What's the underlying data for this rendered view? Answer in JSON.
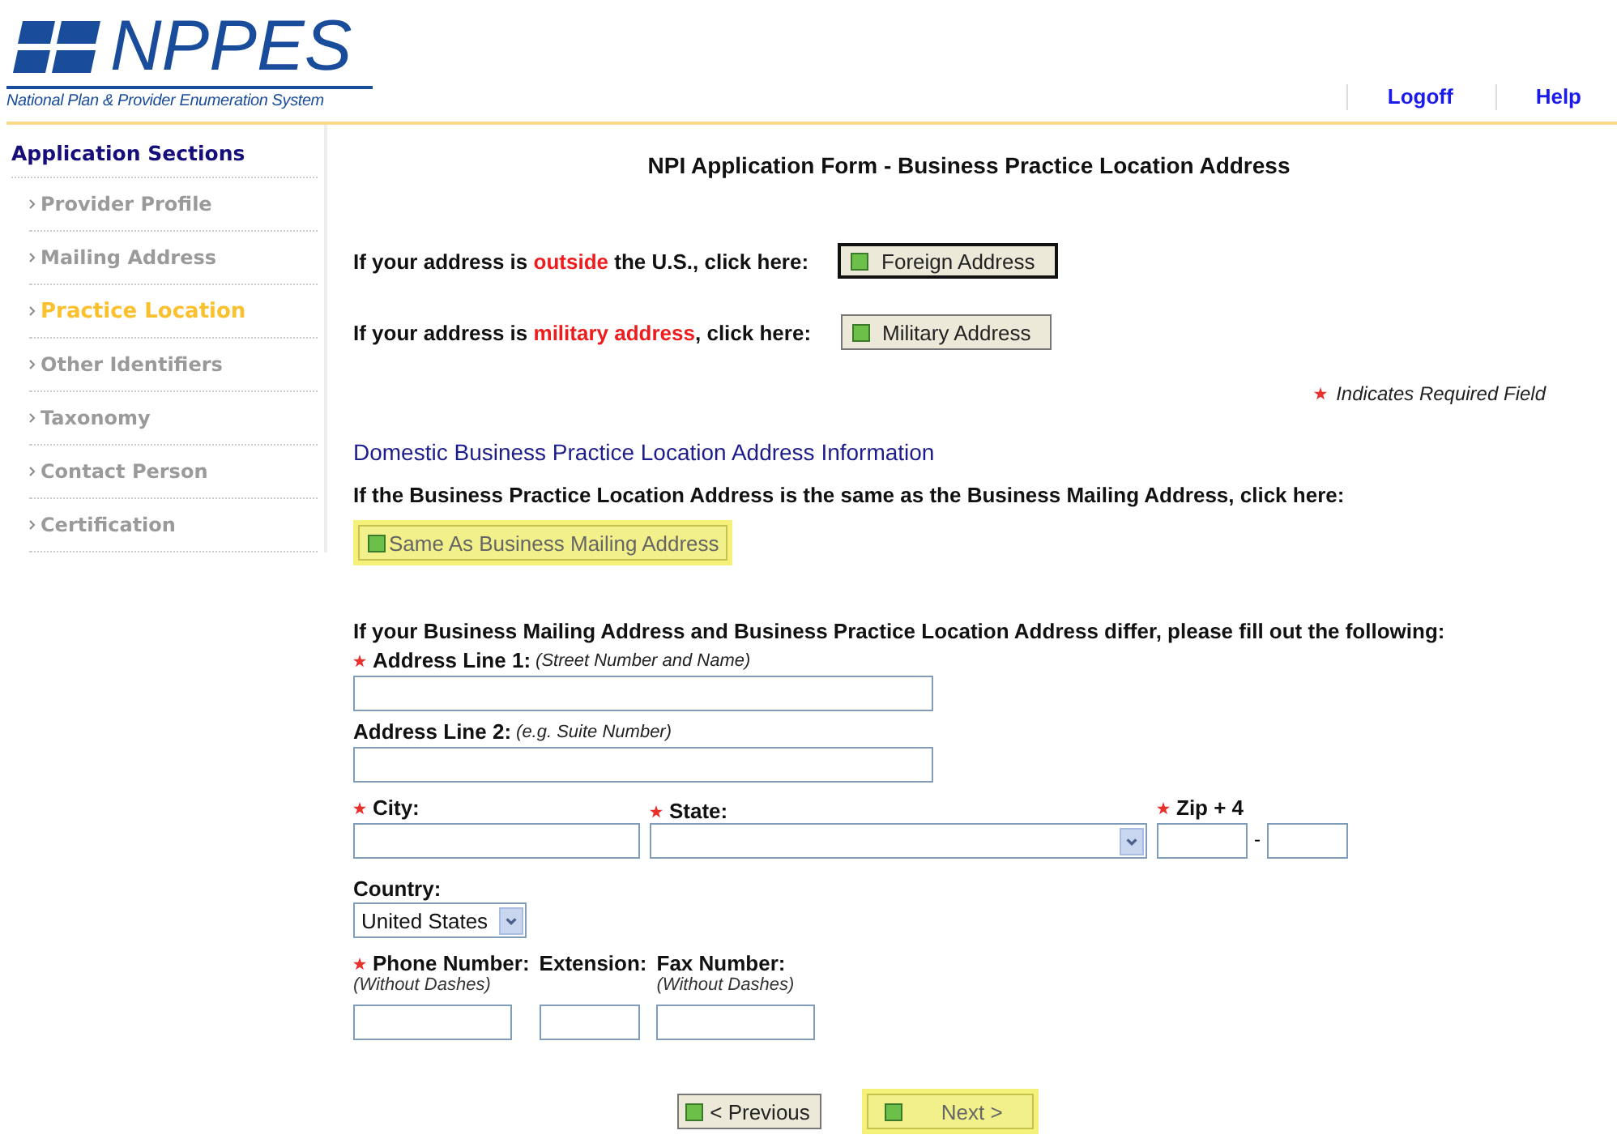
{
  "logo": {
    "name": "NPPES",
    "tagline": "National Plan & Provider Enumeration System"
  },
  "top_links": [
    {
      "label": "Logoff"
    },
    {
      "label": "Help"
    }
  ],
  "sidebar": {
    "title": "Application Sections",
    "items": [
      {
        "label": "Provider Profile",
        "selected": false
      },
      {
        "label": "Mailing Address",
        "selected": false
      },
      {
        "label": "Practice Location",
        "selected": true
      },
      {
        "label": "Other Identifiers",
        "selected": false
      },
      {
        "label": "Taxonomy",
        "selected": false
      },
      {
        "label": "Contact Person",
        "selected": false
      },
      {
        "label": "Certification",
        "selected": false
      }
    ]
  },
  "page_title": "NPI Application Form - Business Practice Location Address",
  "address_options": [
    {
      "before": "If your address is ",
      "emphasis": "outside",
      "after": " the U.S., click here:",
      "button": {
        "label": "Foreign Address",
        "focused": true
      }
    },
    {
      "before": "If your address is ",
      "emphasis": "military address",
      "after": ", click here:",
      "button": {
        "label": "Military Address",
        "focused": false
      }
    }
  ],
  "required_note": "Indicates Required Field",
  "section_heading": "Domestic Business Practice Location Address Information",
  "same_as_prompt": "If the Business Practice Location Address is the same as the Business Mailing Address, click here:",
  "same_as_button": {
    "label": "Same As Business Mailing Address",
    "highlighted": true
  },
  "differ_prompt": "If your Business Mailing Address and Business Practice Location Address differ, please fill out the following:",
  "address_line_1": {
    "label": "Address Line 1:",
    "hint": "(Street Number and Name)",
    "required": true
  },
  "address_line_2": {
    "label": "Address Line 2:",
    "hint": "(e.g. Suite Number)",
    "required": false
  },
  "city": {
    "label": "City:",
    "required": true
  },
  "state": {
    "label": "State:",
    "required": true
  },
  "zip": {
    "label": "Zip + 4",
    "required": true,
    "separator": "-"
  },
  "country": {
    "label": "Country:",
    "value": "United States"
  },
  "phone": {
    "label": "Phone Number:",
    "hint": "(Without Dashes)",
    "required": true
  },
  "extension": {
    "label": "Extension:"
  },
  "fax": {
    "label": "Fax Number:",
    "hint": "(Without Dashes)"
  },
  "nav_buttons": [
    {
      "label": "< Previous",
      "highlighted": false
    },
    {
      "label": "Next >",
      "highlighted": true
    }
  ]
}
